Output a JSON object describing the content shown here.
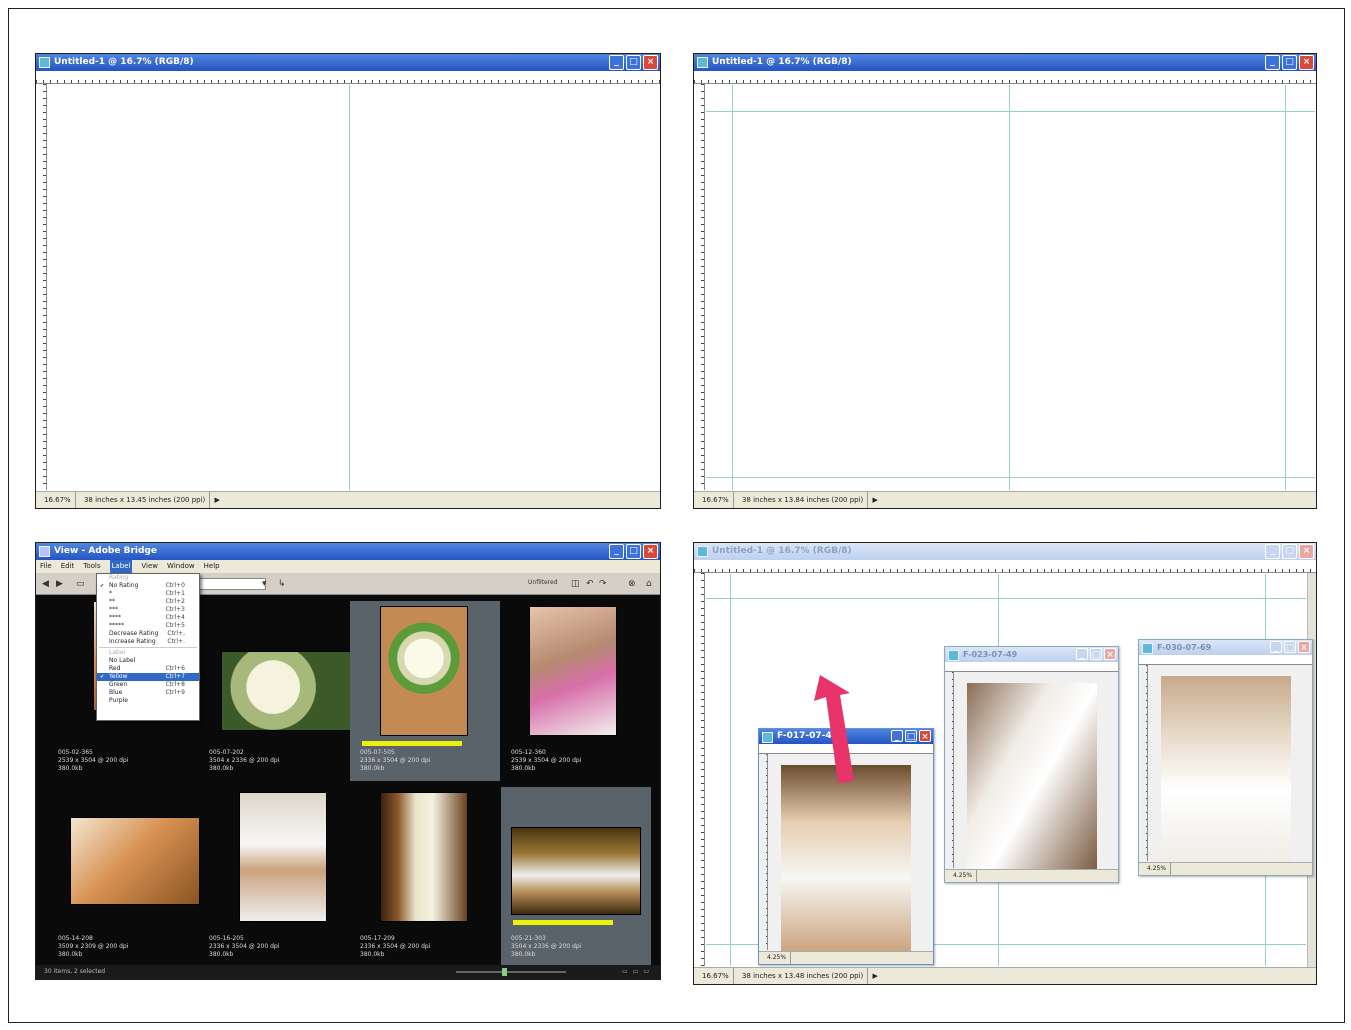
{
  "panel1": {
    "title": "Untitled-1 @ 16.7% (RGB/8)",
    "zoom": "16.67%",
    "doc_info": "38 inches x 13.45 inches (200 ppi)"
  },
  "panel2": {
    "title": "Untitled-1 @ 16.7% (RGB/8)",
    "zoom": "16.67%",
    "doc_info": "38 inches x 13.84 inches (200 ppi)"
  },
  "panel3": {
    "title": "View - Adobe Bridge",
    "menu": [
      "File",
      "Edit",
      "Tools",
      "Label",
      "View",
      "Window",
      "Help"
    ],
    "active_menu": "Label",
    "toolbar_right": "Unfiltered",
    "dropdown": [
      {
        "label": "Rating",
        "shortcut": "",
        "dim": true
      },
      {
        "label": "No Rating",
        "shortcut": "Ctrl+0",
        "checked": true
      },
      {
        "label": "*",
        "shortcut": "Ctrl+1"
      },
      {
        "label": "**",
        "shortcut": "Ctrl+2"
      },
      {
        "label": "***",
        "shortcut": "Ctrl+3"
      },
      {
        "label": "****",
        "shortcut": "Ctrl+4"
      },
      {
        "label": "*****",
        "shortcut": "Ctrl+5"
      },
      {
        "label": "Decrease Rating",
        "shortcut": "Ctrl+,"
      },
      {
        "label": "Increase Rating",
        "shortcut": "Ctrl+."
      },
      {
        "sep": true
      },
      {
        "label": "Label",
        "shortcut": "",
        "dim": true
      },
      {
        "label": "No Label",
        "shortcut": ""
      },
      {
        "label": "Red",
        "shortcut": "Ctrl+6"
      },
      {
        "label": "Yellow",
        "shortcut": "Ctrl+7",
        "checked": true,
        "highlight": true
      },
      {
        "label": "Green",
        "shortcut": "Ctrl+8"
      },
      {
        "label": "Blue",
        "shortcut": "Ctrl+9"
      },
      {
        "label": "Purple",
        "shortcut": ""
      }
    ],
    "thumbnails": [
      {
        "label": "005-02-365\n2539 x 3504 @ 200 dpi\n380.0kb",
        "photo": "hand",
        "selected": false,
        "yellow": false
      },
      {
        "label": "005-07-202\n3504 x 2336 @ 200 dpi\n380.0kb",
        "photo": "flowers",
        "selected": false,
        "yellow": false
      },
      {
        "label": "005-07-505\n2336 x 3504 @ 200 dpi\n380.0kb",
        "photo": "rose",
        "selected": true,
        "yellow": true
      },
      {
        "label": "005-12-360\n2539 x 3504 @ 200 dpi\n380.0kb",
        "photo": "women",
        "selected": false,
        "yellow": false
      },
      {
        "label": "005-14-208\n3509 x 2309 @ 200 dpi\n380.0kb",
        "photo": "hand",
        "selected": false,
        "yellow": false
      },
      {
        "label": "005-16-205\n2336 x 3504 @ 200 dpi\n380.0kb",
        "photo": "hug",
        "selected": false,
        "yellow": false
      },
      {
        "label": "005-17-209\n2336 x 3504 @ 200 dpi\n380.0kb",
        "photo": "window",
        "selected": false,
        "yellow": false
      },
      {
        "label": "005-21-303\n3504 x 2336 @ 200 dpi\n380.0kb",
        "photo": "mirror",
        "selected": true,
        "yellow": true
      }
    ],
    "status": "30 items, 2 selected"
  },
  "panel4": {
    "title": "Untitled-1 @ 16.7% (RGB/8)",
    "zoom": "16.67%",
    "doc_info": "38 inches x 13.48 inches (200 ppi)",
    "subwindows": [
      {
        "title": "F-017-07-47",
        "zoom": "4.25%",
        "photo": "bride"
      },
      {
        "title": "F-023-07-49",
        "zoom": "4.25%",
        "photo": "dress"
      },
      {
        "title": "F-030-07-69",
        "zoom": "4.25%",
        "photo": "hands"
      }
    ],
    "arrow_color": "#e8336b"
  },
  "colors": {
    "guide": "#8fd3c9",
    "titlebar": "#2554c2",
    "highlight_label": "#e8f20c"
  }
}
